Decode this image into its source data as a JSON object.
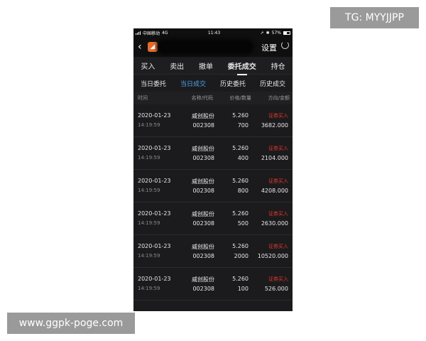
{
  "watermarks": {
    "top": "TG: MYYJJPP",
    "bottom": "www.ggpk-poge.com"
  },
  "status_bar": {
    "carrier": "中国移动",
    "network": "4G",
    "time": "11:43",
    "battery": "57%"
  },
  "header": {
    "settings": "设置"
  },
  "tabs": [
    {
      "label": "买入"
    },
    {
      "label": "卖出"
    },
    {
      "label": "撤单"
    },
    {
      "label": "委托成交",
      "active": true
    },
    {
      "label": "持仓"
    }
  ],
  "subtabs": [
    {
      "label": "当日委托"
    },
    {
      "label": "当日成交",
      "active": true
    },
    {
      "label": "历史委托"
    },
    {
      "label": "历史成交"
    }
  ],
  "columns": {
    "time": "时间",
    "name_code": "名称/代码",
    "price_qty": "价格/数量",
    "direction_amount": "方向/金额"
  },
  "trades": [
    {
      "date": "2020-01-23",
      "time": "14:19:59",
      "name": "威创股份",
      "code": "002308",
      "price": "5.260",
      "qty": "700",
      "direction": "证券买入",
      "amount": "3682.000"
    },
    {
      "date": "2020-01-23",
      "time": "14:19:59",
      "name": "威创股份",
      "code": "002308",
      "price": "5.260",
      "qty": "400",
      "direction": "证券买入",
      "amount": "2104.000"
    },
    {
      "date": "2020-01-23",
      "time": "14:19:59",
      "name": "威创股份",
      "code": "002308",
      "price": "5.260",
      "qty": "800",
      "direction": "证券买入",
      "amount": "4208.000"
    },
    {
      "date": "2020-01-23",
      "time": "14:19:59",
      "name": "威创股份",
      "code": "002308",
      "price": "5.260",
      "qty": "500",
      "direction": "证券买入",
      "amount": "2630.000"
    },
    {
      "date": "2020-01-23",
      "time": "14:19:59",
      "name": "威创股份",
      "code": "002308",
      "price": "5.260",
      "qty": "2000",
      "direction": "证券买入",
      "amount": "10520.000"
    },
    {
      "date": "2020-01-23",
      "time": "14:19:59",
      "name": "威创股份",
      "code": "002308",
      "price": "5.260",
      "qty": "100",
      "direction": "证券买入",
      "amount": "526.000"
    }
  ]
}
